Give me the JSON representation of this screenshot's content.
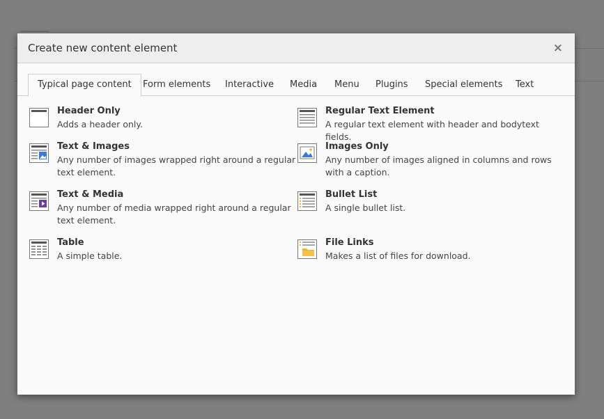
{
  "modal": {
    "title": "Create new content element",
    "close_label": "×"
  },
  "tabs": [
    {
      "label": "Typical page content",
      "active": true
    },
    {
      "label": "Form elements"
    },
    {
      "label": "Interactive"
    },
    {
      "label": "Media"
    },
    {
      "label": "Menu"
    },
    {
      "label": "Plugins"
    },
    {
      "label": "Special elements"
    },
    {
      "label": "Text"
    }
  ],
  "elements": [
    {
      "title": "Header Only",
      "description": "Adds a header only.",
      "icon": "header-only-icon"
    },
    {
      "title": "Regular Text Element",
      "description": "A regular text element with header and bodytext fields.",
      "icon": "regular-text-icon"
    },
    {
      "title": "Text & Images",
      "description": "Any number of images wrapped right around a regular text element.",
      "icon": "text-images-icon"
    },
    {
      "title": "Images Only",
      "description": "Any number of images aligned in columns and rows with a caption.",
      "icon": "images-only-icon"
    },
    {
      "title": "Text & Media",
      "description": "Any number of media wrapped right around a regular text element.",
      "icon": "text-media-icon"
    },
    {
      "title": "Bullet List",
      "description": "A single bullet list.",
      "icon": "bullet-list-icon"
    },
    {
      "title": "Table",
      "description": "A simple table.",
      "icon": "table-icon"
    },
    {
      "title": "File Links",
      "description": "Makes a list of files for download.",
      "icon": "file-links-icon"
    }
  ],
  "colors": {
    "backdrop": "#7f7f7f",
    "modal_bg": "#fafafa",
    "header_bg": "#eeeeee",
    "accent_blue": "#3a7bd5",
    "accent_purple": "#6b3fa0",
    "accent_orange": "#f0b030"
  }
}
